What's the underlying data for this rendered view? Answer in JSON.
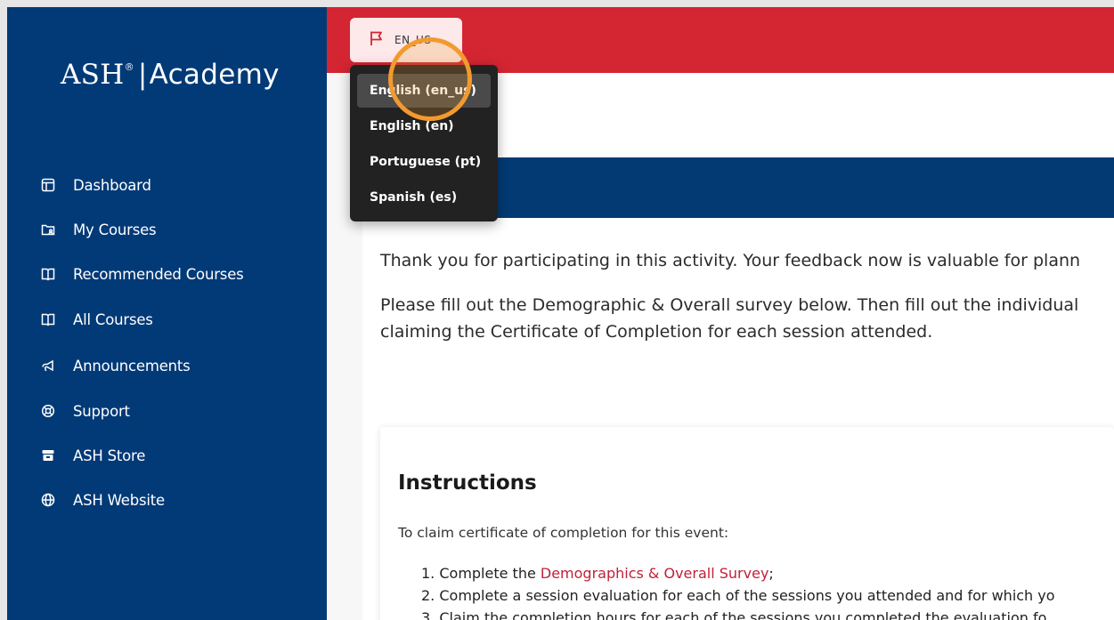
{
  "sidebar": {
    "brand": {
      "ash": "ASH",
      "reg": "®",
      "sep": "|",
      "academy": "Academy"
    },
    "items": [
      {
        "label": "Dashboard",
        "icon": "dashboard-icon"
      },
      {
        "label": "My Courses",
        "icon": "folder-user-icon"
      },
      {
        "label": "Recommended Courses",
        "icon": "book-open-icon"
      },
      {
        "label": "All Courses",
        "icon": "book-open-icon"
      },
      {
        "label": "Announcements",
        "icon": "megaphone-icon"
      },
      {
        "label": "Support",
        "icon": "lifebuoy-icon"
      },
      {
        "label": "ASH Store",
        "icon": "store-icon"
      },
      {
        "label": "ASH Website",
        "icon": "globe-icon"
      }
    ]
  },
  "topbar": {
    "language_button": {
      "code": "EN_US",
      "icon": "flag-icon"
    }
  },
  "language_menu": {
    "options": [
      "English (en_us)",
      "English (en)",
      "Portuguese (pt)",
      "Spanish (es)"
    ],
    "highlighted": "English (en_us)"
  },
  "content": {
    "para1": "Thank you for participating in this activity. Your feedback now is valuable for plann",
    "para2_line1": "Please fill out the Demographic & Overall survey below. Then fill out the individual",
    "para2_line2": "claiming the Certificate of Completion for each session attended."
  },
  "instructions": {
    "title": "Instructions",
    "subtitle": "To claim certificate of completion for this event:",
    "step1_prefix": "1. Complete the ",
    "step1_link": "Demographics & Overall Survey",
    "step1_suffix": ";",
    "step2": "2. Complete a session evaluation for each of the sessions you attended and for which yo",
    "step3": "3. Claim the completion hours for each of the sessions you completed the evaluation fo"
  },
  "colors": {
    "sidebar_bg": "#023a77",
    "topbar_red": "#d42532",
    "banner_blue": "#033a73",
    "link_red": "#c0203a",
    "click_highlight": "#f29a2f"
  }
}
